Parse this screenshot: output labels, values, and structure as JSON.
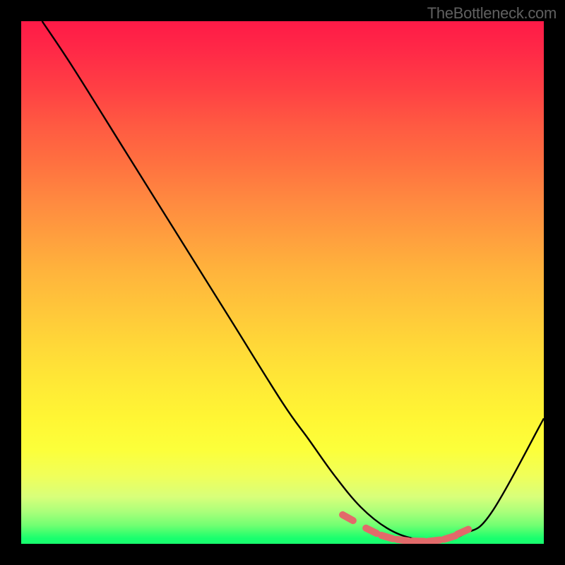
{
  "watermark": "TheBottleneck.com",
  "chart_data": {
    "type": "line",
    "title": "",
    "xlabel": "",
    "ylabel": "",
    "xlim": [
      0,
      100
    ],
    "ylim": [
      0,
      100
    ],
    "series": [
      {
        "name": "curve",
        "x": [
          4,
          10,
          20,
          30,
          40,
          50,
          55,
          60,
          65,
          70,
          75,
          80,
          85,
          90,
          100
        ],
        "y": [
          100,
          91,
          75,
          59,
          43,
          27,
          20,
          13,
          7,
          3,
          1,
          0.5,
          2,
          6,
          24
        ]
      },
      {
        "name": "highlight-markers",
        "x": [
          62.5,
          67,
          70,
          73,
          76,
          79,
          82,
          84.5
        ],
        "y": [
          5,
          2.5,
          1.3,
          0.7,
          0.5,
          0.6,
          1.2,
          2.3
        ]
      }
    ],
    "gradient_background": {
      "top_color": "#ff1a47",
      "bottom_color": "#18ff6e",
      "description": "Red at top fading through orange, yellow to green at bottom"
    }
  }
}
